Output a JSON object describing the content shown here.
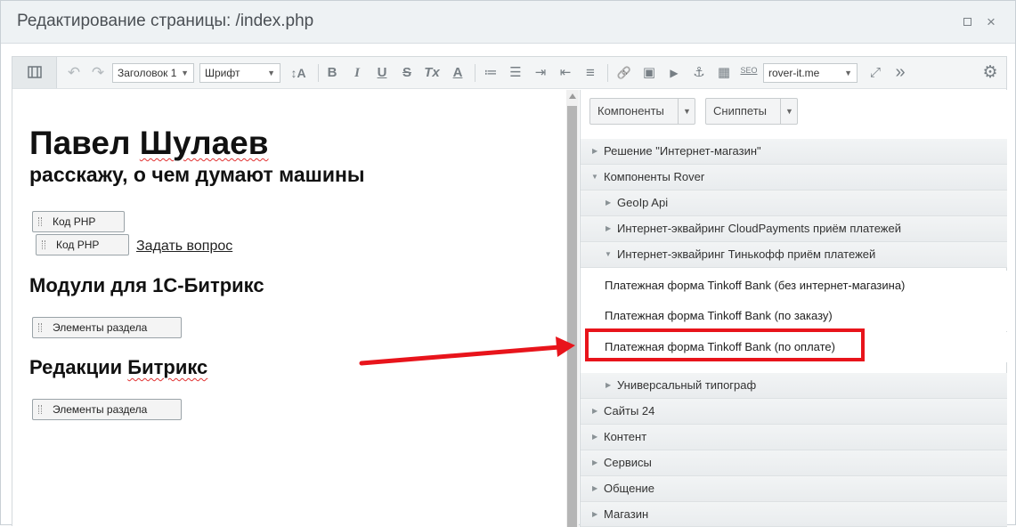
{
  "window": {
    "title": "Редактирование страницы: /index.php",
    "maximize_icon": "maximize-icon",
    "close_icon": "close-icon",
    "close_glyph": "×"
  },
  "toolbar": {
    "undo_glyph": "↶",
    "redo_glyph": "↷",
    "heading_select": "Заголовок 1",
    "font_select": "Шрифт",
    "font_size_glyph": "↕A",
    "bold_glyph": "B",
    "italic_glyph": "I",
    "underline_glyph": "U",
    "strike_glyph": "S",
    "clear_format_glyph": "Tx",
    "font_color_glyph": "A",
    "ordered_list_glyph": "≔",
    "unordered_list_glyph": "☰",
    "indent_glyph": "⇥",
    "outdent_glyph": "⇤",
    "align_glyph": "≡",
    "link_glyph": "🔗",
    "image_glyph": "▣",
    "video_glyph": "▶",
    "anchor_glyph": "⚓",
    "table_glyph": "▦",
    "seo_label": "SEO",
    "site_select": "rover-it.me",
    "fullscreen_glyph": "⤢",
    "more_glyph": "»",
    "settings_glyph": "⚙"
  },
  "content": {
    "title_part1": "Павел ",
    "title_part2": "Шулаев",
    "subtitle": "расскажу, о чем думают машины",
    "php_block_1": "Код PHP",
    "php_block_2": "Код PHP",
    "ask_link": "Задать вопрос",
    "modules_heading": "Модули для 1С-Битрикс",
    "section_block_1": "Элементы раздела",
    "editions_part1": "Редакции ",
    "editions_part2": "Битрикс",
    "section_block_2": "Элементы раздела"
  },
  "panel": {
    "components_button": "Компоненты",
    "snippets_button": "Сниппеты",
    "expanded_glyph": "▼",
    "collapsed_glyph": "▶",
    "tree": [
      {
        "label": "Решение \"Интернет-магазин\""
      },
      {
        "label": "Компоненты Rover"
      },
      {
        "label": "GeoIp Api"
      },
      {
        "label": "Интернет-эквайринг CloudPayments приём платежей"
      },
      {
        "label": "Интернет-эквайринг Тинькофф приём платежей"
      },
      {
        "label": "Платежная форма Tinkoff Bank (без интернет-магазина)"
      },
      {
        "label": "Платежная форма Tinkoff Bank (по заказу)"
      },
      {
        "label": "Платежная форма Tinkoff Bank (по оплате)"
      },
      {
        "label": "Универсальный типограф"
      },
      {
        "label": "Сайты 24"
      },
      {
        "label": "Контент"
      },
      {
        "label": "Сервисы"
      },
      {
        "label": "Общение"
      },
      {
        "label": "Магазин"
      }
    ]
  },
  "annotation": {
    "color": "#e8141b"
  }
}
